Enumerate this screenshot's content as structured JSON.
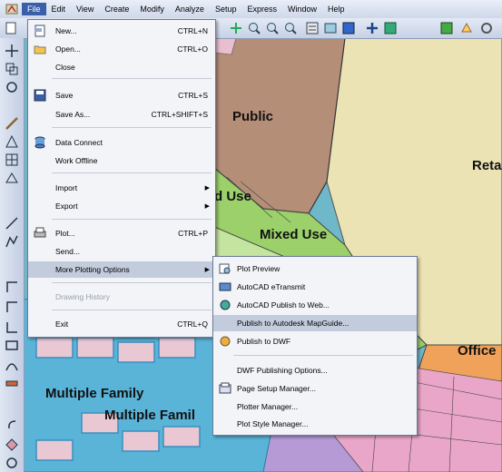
{
  "menubar": {
    "items": [
      "File",
      "Edit",
      "View",
      "Create",
      "Modify",
      "Analyze",
      "Setup",
      "Express",
      "Window",
      "Help"
    ],
    "active": "File"
  },
  "map": {
    "labels": [
      "Public",
      "Reta",
      "d Use",
      "Mixed Use",
      "Office",
      "Multiple Family",
      "Multiple Famil"
    ],
    "colors": {
      "public": "#b58e78",
      "retail": "#ece3b4",
      "mixed": "#9bd06a",
      "water": "#5ab4d8",
      "residential": "#eaa6c8",
      "office": "#f0a25a",
      "purple": "#b59ad6"
    }
  },
  "file_menu": {
    "items": [
      {
        "label": "New...",
        "shortcut": "CTRL+N",
        "icon": "new-file-icon"
      },
      {
        "label": "Open...",
        "shortcut": "CTRL+O",
        "icon": "open-folder-icon"
      },
      {
        "label": "Close",
        "shortcut": ""
      },
      {
        "label": "Save",
        "shortcut": "CTRL+S",
        "icon": "save-disk-icon"
      },
      {
        "label": "Save As...",
        "shortcut": "CTRL+SHIFT+S"
      },
      {
        "label": "Data Connect",
        "shortcut": "",
        "icon": "database-icon"
      },
      {
        "label": "Work Offline",
        "shortcut": ""
      },
      {
        "label": "Import",
        "shortcut": "",
        "submenu": true
      },
      {
        "label": "Export",
        "shortcut": "",
        "submenu": true
      },
      {
        "label": "Plot...",
        "shortcut": "CTRL+P",
        "icon": "plot-icon"
      },
      {
        "label": "Send...",
        "shortcut": ""
      },
      {
        "label": "More Plotting Options",
        "shortcut": "",
        "submenu": true,
        "highlighted": true
      },
      {
        "label": "Drawing History",
        "shortcut": "",
        "disabled": true
      },
      {
        "label": "Exit",
        "shortcut": "CTRL+Q"
      }
    ]
  },
  "plot_submenu": {
    "items": [
      {
        "label": "Plot Preview",
        "icon": "plot-preview-icon"
      },
      {
        "label": "AutoCAD eTransmit",
        "icon": "etransmit-icon"
      },
      {
        "label": "AutoCAD Publish to Web...",
        "icon": "publish-web-icon"
      },
      {
        "label": "Publish to Autodesk MapGuide...",
        "highlighted": true
      },
      {
        "label": "Publish to DWF",
        "icon": "publish-dwf-icon"
      },
      {
        "label": "DWF Publishing Options..."
      },
      {
        "label": "Page Setup Manager...",
        "icon": "page-setup-icon"
      },
      {
        "label": "Plotter Manager..."
      },
      {
        "label": "Plot Style Manager..."
      }
    ]
  }
}
